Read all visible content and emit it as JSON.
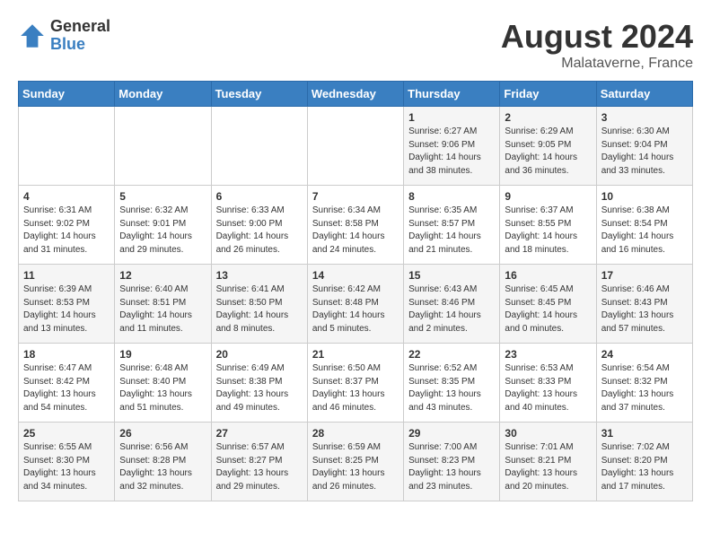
{
  "logo": {
    "general": "General",
    "blue": "Blue"
  },
  "header": {
    "month_year": "August 2024",
    "location": "Malataverne, France"
  },
  "days_of_week": [
    "Sunday",
    "Monday",
    "Tuesday",
    "Wednesday",
    "Thursday",
    "Friday",
    "Saturday"
  ],
  "weeks": [
    [
      {
        "day": "",
        "info": ""
      },
      {
        "day": "",
        "info": ""
      },
      {
        "day": "",
        "info": ""
      },
      {
        "day": "",
        "info": ""
      },
      {
        "day": "1",
        "info": "Sunrise: 6:27 AM\nSunset: 9:06 PM\nDaylight: 14 hours\nand 38 minutes."
      },
      {
        "day": "2",
        "info": "Sunrise: 6:29 AM\nSunset: 9:05 PM\nDaylight: 14 hours\nand 36 minutes."
      },
      {
        "day": "3",
        "info": "Sunrise: 6:30 AM\nSunset: 9:04 PM\nDaylight: 14 hours\nand 33 minutes."
      }
    ],
    [
      {
        "day": "4",
        "info": "Sunrise: 6:31 AM\nSunset: 9:02 PM\nDaylight: 14 hours\nand 31 minutes."
      },
      {
        "day": "5",
        "info": "Sunrise: 6:32 AM\nSunset: 9:01 PM\nDaylight: 14 hours\nand 29 minutes."
      },
      {
        "day": "6",
        "info": "Sunrise: 6:33 AM\nSunset: 9:00 PM\nDaylight: 14 hours\nand 26 minutes."
      },
      {
        "day": "7",
        "info": "Sunrise: 6:34 AM\nSunset: 8:58 PM\nDaylight: 14 hours\nand 24 minutes."
      },
      {
        "day": "8",
        "info": "Sunrise: 6:35 AM\nSunset: 8:57 PM\nDaylight: 14 hours\nand 21 minutes."
      },
      {
        "day": "9",
        "info": "Sunrise: 6:37 AM\nSunset: 8:55 PM\nDaylight: 14 hours\nand 18 minutes."
      },
      {
        "day": "10",
        "info": "Sunrise: 6:38 AM\nSunset: 8:54 PM\nDaylight: 14 hours\nand 16 minutes."
      }
    ],
    [
      {
        "day": "11",
        "info": "Sunrise: 6:39 AM\nSunset: 8:53 PM\nDaylight: 14 hours\nand 13 minutes."
      },
      {
        "day": "12",
        "info": "Sunrise: 6:40 AM\nSunset: 8:51 PM\nDaylight: 14 hours\nand 11 minutes."
      },
      {
        "day": "13",
        "info": "Sunrise: 6:41 AM\nSunset: 8:50 PM\nDaylight: 14 hours\nand 8 minutes."
      },
      {
        "day": "14",
        "info": "Sunrise: 6:42 AM\nSunset: 8:48 PM\nDaylight: 14 hours\nand 5 minutes."
      },
      {
        "day": "15",
        "info": "Sunrise: 6:43 AM\nSunset: 8:46 PM\nDaylight: 14 hours\nand 2 minutes."
      },
      {
        "day": "16",
        "info": "Sunrise: 6:45 AM\nSunset: 8:45 PM\nDaylight: 14 hours\nand 0 minutes."
      },
      {
        "day": "17",
        "info": "Sunrise: 6:46 AM\nSunset: 8:43 PM\nDaylight: 13 hours\nand 57 minutes."
      }
    ],
    [
      {
        "day": "18",
        "info": "Sunrise: 6:47 AM\nSunset: 8:42 PM\nDaylight: 13 hours\nand 54 minutes."
      },
      {
        "day": "19",
        "info": "Sunrise: 6:48 AM\nSunset: 8:40 PM\nDaylight: 13 hours\nand 51 minutes."
      },
      {
        "day": "20",
        "info": "Sunrise: 6:49 AM\nSunset: 8:38 PM\nDaylight: 13 hours\nand 49 minutes."
      },
      {
        "day": "21",
        "info": "Sunrise: 6:50 AM\nSunset: 8:37 PM\nDaylight: 13 hours\nand 46 minutes."
      },
      {
        "day": "22",
        "info": "Sunrise: 6:52 AM\nSunset: 8:35 PM\nDaylight: 13 hours\nand 43 minutes."
      },
      {
        "day": "23",
        "info": "Sunrise: 6:53 AM\nSunset: 8:33 PM\nDaylight: 13 hours\nand 40 minutes."
      },
      {
        "day": "24",
        "info": "Sunrise: 6:54 AM\nSunset: 8:32 PM\nDaylight: 13 hours\nand 37 minutes."
      }
    ],
    [
      {
        "day": "25",
        "info": "Sunrise: 6:55 AM\nSunset: 8:30 PM\nDaylight: 13 hours\nand 34 minutes."
      },
      {
        "day": "26",
        "info": "Sunrise: 6:56 AM\nSunset: 8:28 PM\nDaylight: 13 hours\nand 32 minutes."
      },
      {
        "day": "27",
        "info": "Sunrise: 6:57 AM\nSunset: 8:27 PM\nDaylight: 13 hours\nand 29 minutes."
      },
      {
        "day": "28",
        "info": "Sunrise: 6:59 AM\nSunset: 8:25 PM\nDaylight: 13 hours\nand 26 minutes."
      },
      {
        "day": "29",
        "info": "Sunrise: 7:00 AM\nSunset: 8:23 PM\nDaylight: 13 hours\nand 23 minutes."
      },
      {
        "day": "30",
        "info": "Sunrise: 7:01 AM\nSunset: 8:21 PM\nDaylight: 13 hours\nand 20 minutes."
      },
      {
        "day": "31",
        "info": "Sunrise: 7:02 AM\nSunset: 8:20 PM\nDaylight: 13 hours\nand 17 minutes."
      }
    ]
  ]
}
